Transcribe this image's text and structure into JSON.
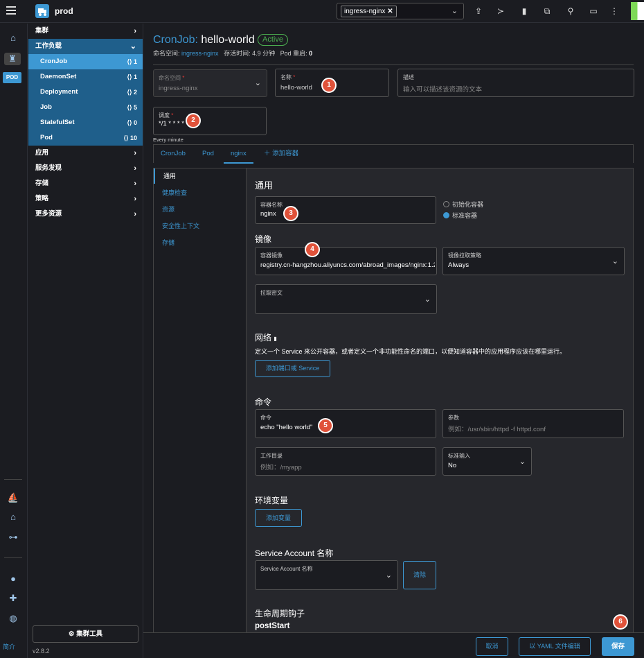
{
  "header": {
    "cluster_name": "prod",
    "namespace_chip": "ingress-nginx",
    "icons": [
      "upload-icon",
      "terminal-icon",
      "file-icon",
      "copy-icon",
      "search-icon",
      "book-icon",
      "more-icon"
    ]
  },
  "rail": {
    "pod_badge": "POD"
  },
  "sidebar": {
    "groups": {
      "cluster": "集群",
      "workloads": "工作负载",
      "apps": "应用",
      "service_discovery": "服务发现",
      "storage": "存储",
      "policy": "策略",
      "more": "更多资源"
    },
    "items": [
      {
        "label": "CronJob",
        "count": "1"
      },
      {
        "label": "DaemonSet",
        "count": "1"
      },
      {
        "label": "Deployment",
        "count": "2"
      },
      {
        "label": "Job",
        "count": "5"
      },
      {
        "label": "StatefulSet",
        "count": "0"
      },
      {
        "label": "Pod",
        "count": "10"
      }
    ],
    "cluster_tools": "集群工具",
    "version": "v2.8.2",
    "intro": "简介"
  },
  "page": {
    "kind": "CronJob:",
    "name": "hello-world",
    "status": "Active",
    "meta": {
      "ns_label": "命名空间:",
      "ns_value": "ingress-nginx",
      "age_label": "存活时间:",
      "age_value": "4.9 分钟",
      "restart_label": "Pod 重启:",
      "restart_value": "0"
    }
  },
  "form": {
    "namespace": {
      "label": "命名空间",
      "value": "ingress-nginx"
    },
    "name": {
      "label": "名称",
      "value": "hello-world"
    },
    "description": {
      "label": "描述",
      "placeholder": "输入可以描述该资源的文本"
    },
    "schedule": {
      "label": "调度",
      "value": "*/1 * * * *",
      "hint": "Every minute"
    }
  },
  "tabs": [
    "CronJob",
    "Pod",
    "nginx",
    "添加容器"
  ],
  "side_tabs": [
    "通用",
    "健康检查",
    "资源",
    "安全性上下文",
    "存储"
  ],
  "panel": {
    "general_title": "通用",
    "container_name": {
      "label": "容器名称",
      "value": "nginx"
    },
    "radio_init": "初始化容器",
    "radio_standard": "标准容器",
    "image_title": "镜像",
    "image": {
      "label": "容器镜像",
      "value": "registry.cn-hangzhou.aliyuncs.com/abroad_images/nginx:1.2."
    },
    "pull_policy": {
      "label": "镜像拉取策略",
      "value": "Always"
    },
    "pull_secret": {
      "label": "拉取密文"
    },
    "network_title": "网络",
    "network_desc": "定义一个 Service 来公开容器，或者定义一个非功能性命名的端口，以便知道容器中的应用程序应该在哪里运行。",
    "add_port": "添加端口或 Service",
    "command_title": "命令",
    "command": {
      "label": "命令",
      "value": "echo \"hello world\""
    },
    "args": {
      "label": "参数",
      "placeholder": "例如：/usr/sbin/httpd -f httpd.conf"
    },
    "workdir": {
      "label": "工作目录",
      "placeholder": "例如：/myapp"
    },
    "stdin": {
      "label": "标准输入",
      "value": "No"
    },
    "env_title": "环境变量",
    "add_env": "添加变量",
    "sa_title": "Service Account 名称",
    "sa": {
      "label": "Service Account 名称"
    },
    "clear": "清除",
    "lifecycle_title": "生命周期钩子",
    "post_start": "postStart"
  },
  "footer": {
    "cancel": "取消",
    "yaml": "以 YAML 文件编辑",
    "save": "保存"
  },
  "markers": [
    "1",
    "2",
    "3",
    "4",
    "5",
    "6"
  ],
  "colors": {
    "accent": "#3d98d3",
    "active": "#4caf50",
    "marker": "#e0523a"
  }
}
